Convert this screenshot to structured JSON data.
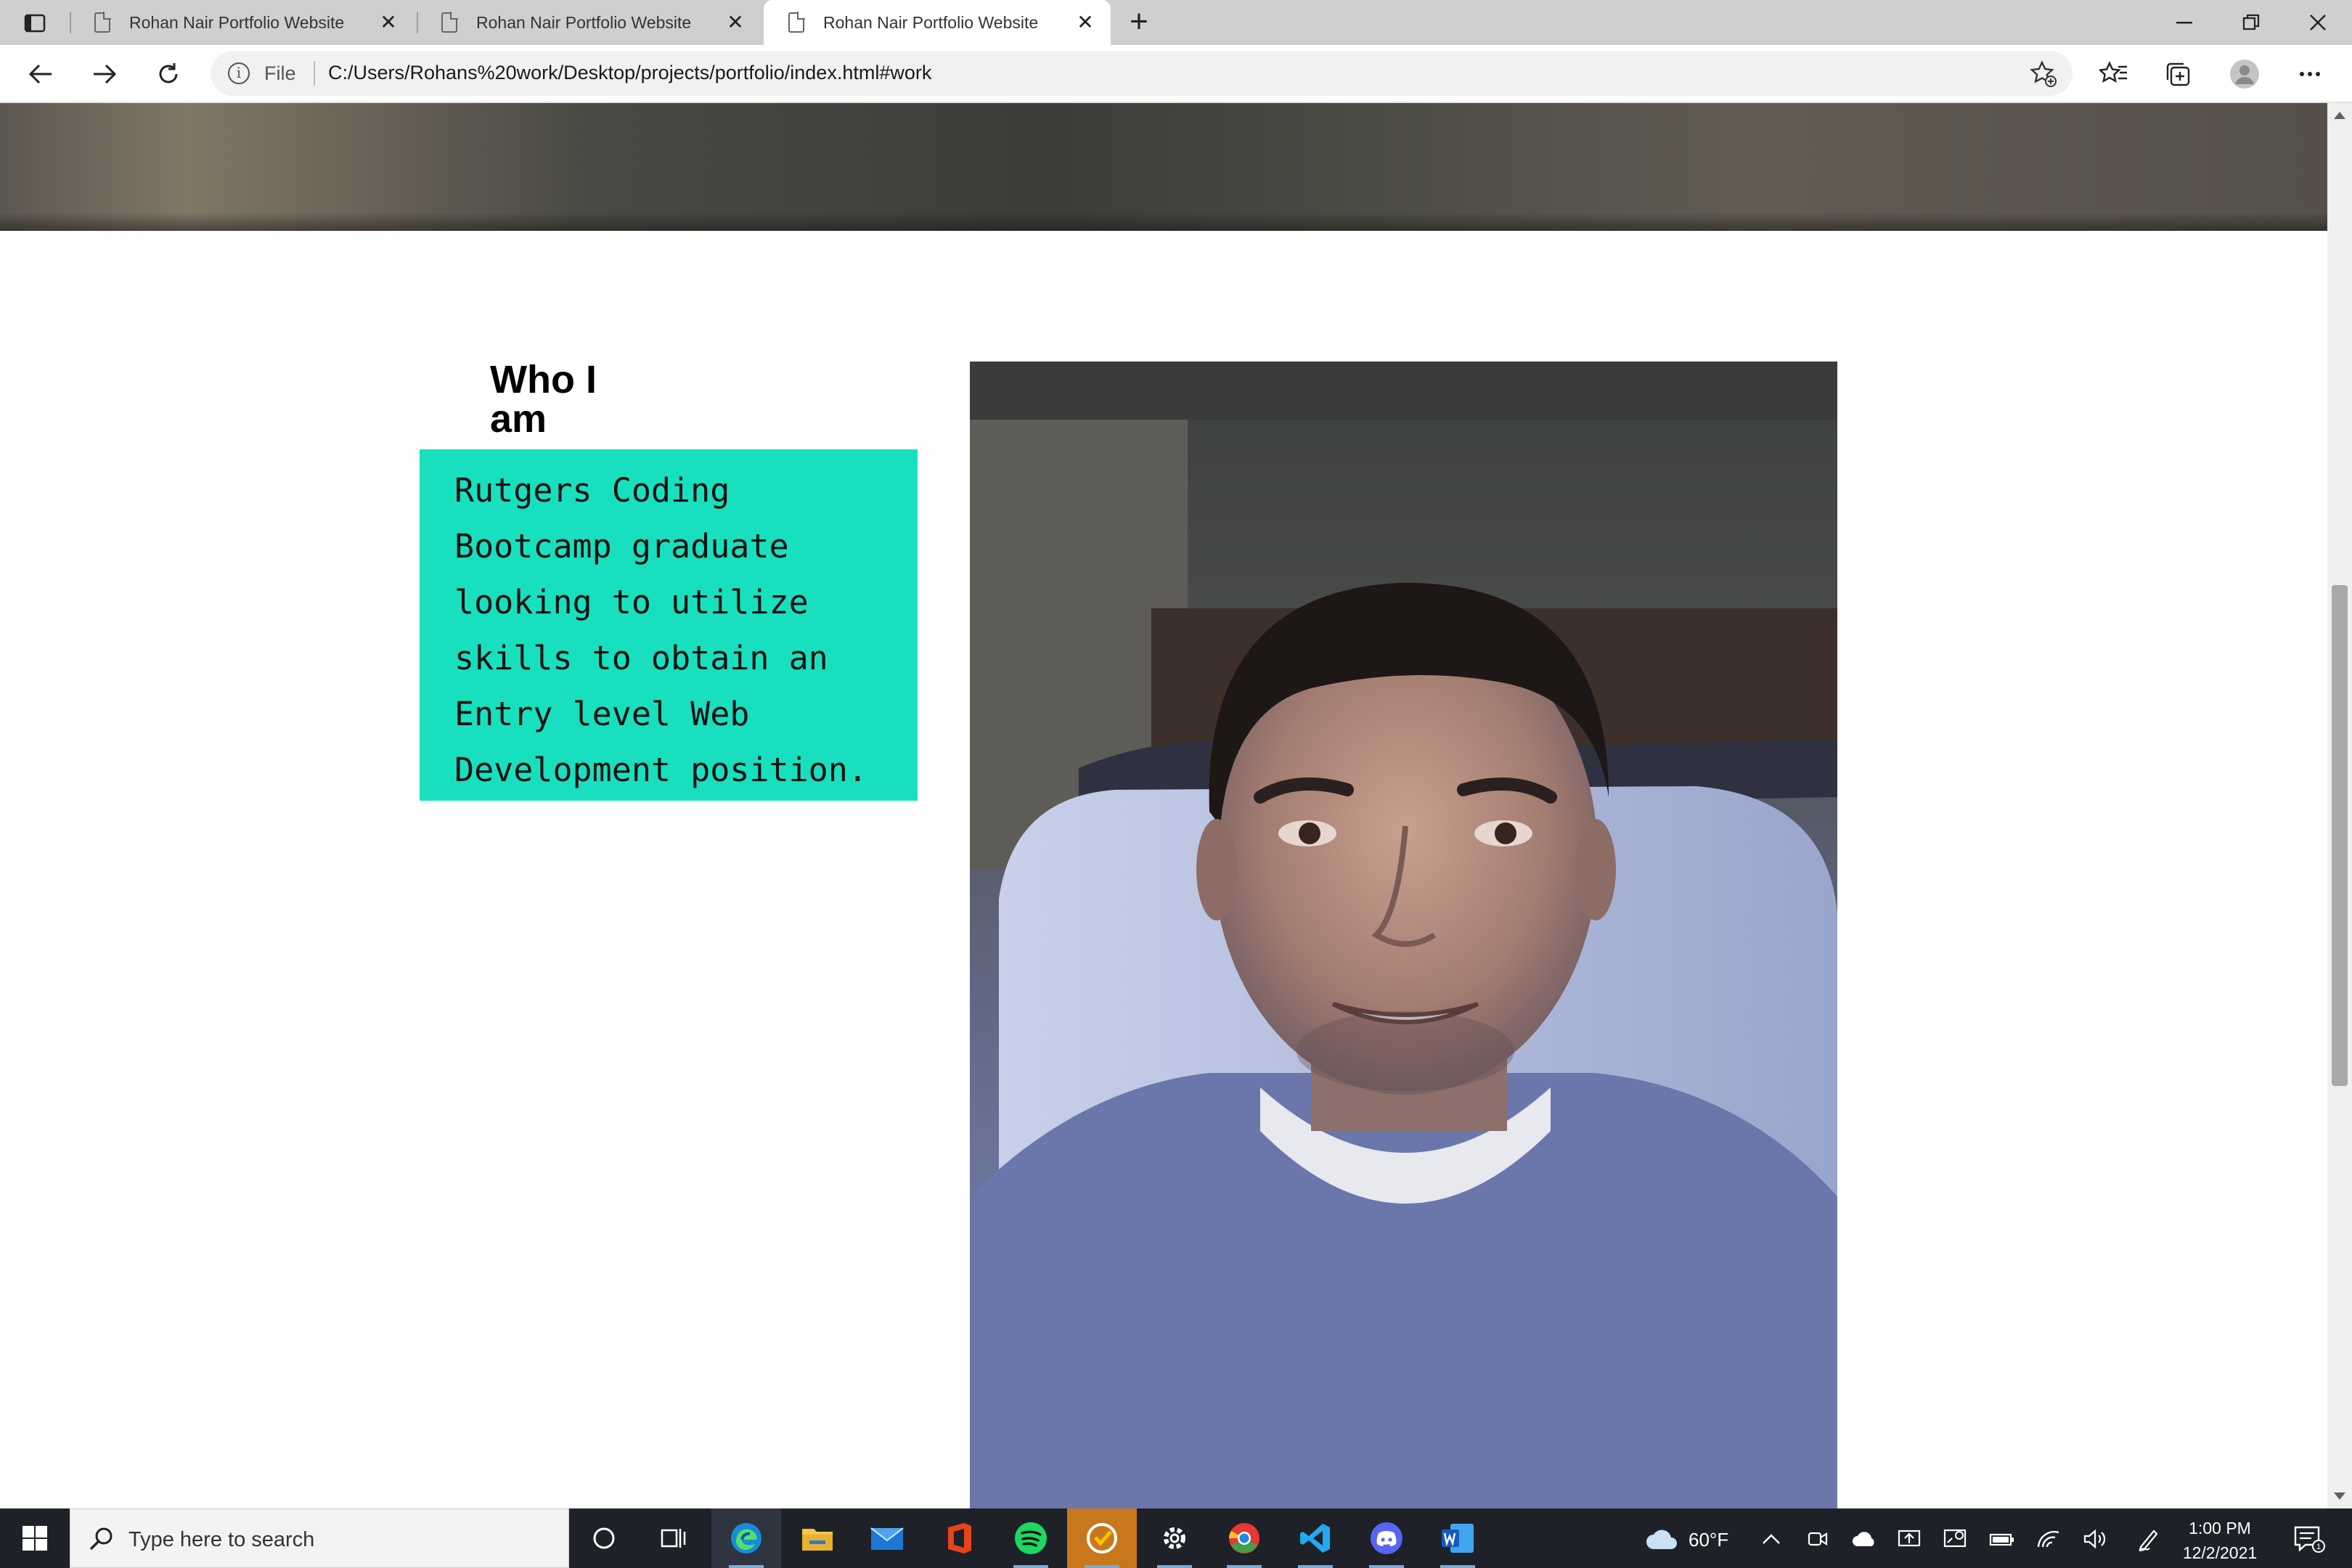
{
  "browser": {
    "tabs": [
      {
        "title": "Rohan Nair Portfolio Website",
        "active": false
      },
      {
        "title": "Rohan Nair Portfolio Website",
        "active": false
      },
      {
        "title": "Rohan Nair Portfolio Website",
        "active": true
      }
    ],
    "address": {
      "scheme_label": "File",
      "url": "C:/Users/Rohans%20work/Desktop/projects/portfolio/index.html#work"
    }
  },
  "page": {
    "about": {
      "title": "Who I am",
      "text": "Rutgers Coding Bootcamp graduate looking to utilize skills to obtain an Entry level Web Development position.",
      "box_color": "#18e0be"
    },
    "photo_alt": "Profile photo"
  },
  "taskbar": {
    "search_placeholder": "Type here to search",
    "pinned": [
      "cortana-icon",
      "task-view-icon",
      "edge-icon",
      "file-explorer-icon",
      "mail-icon",
      "office-icon",
      "spotify-icon",
      "norton-icon",
      "settings-icon",
      "chrome-icon",
      "vscode-icon",
      "discord-icon",
      "word-icon"
    ],
    "weather": "60°F",
    "time": "1:00 PM",
    "date": "12/2/2021",
    "notification_count": "1"
  }
}
